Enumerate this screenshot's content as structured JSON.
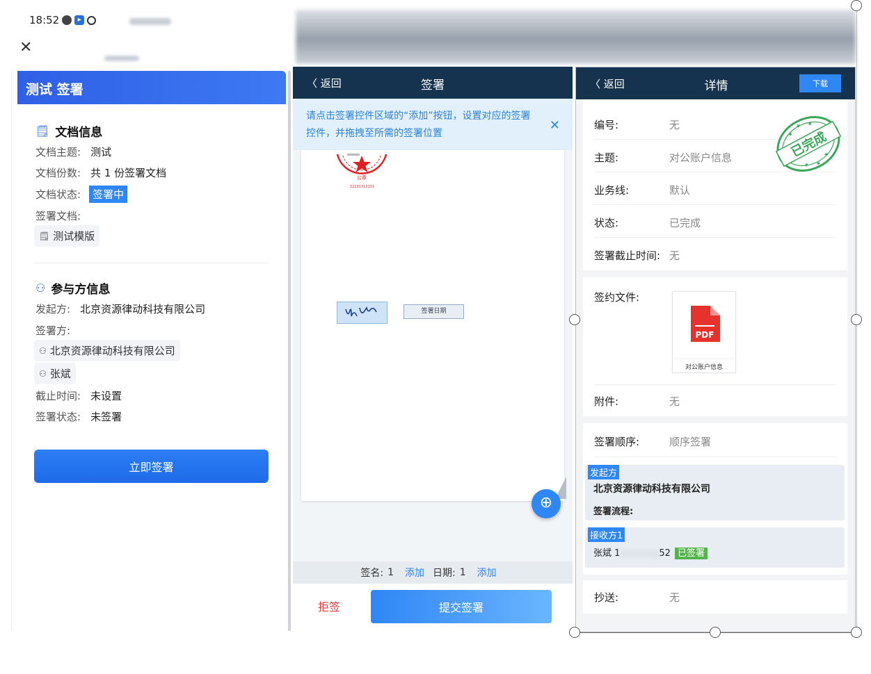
{
  "status_bar": {
    "time": "18:52"
  },
  "panel1": {
    "header_title": "测试 签署",
    "doc_section": {
      "title": "文档信息",
      "subject_label": "文档主题:",
      "subject_value": "测试",
      "copies_label": "文档份数:",
      "copies_value": "共 1 份签署文档",
      "status_label": "文档状态:",
      "status_value": "签署中",
      "files_label": "签署文档:",
      "file_chip": "测试模版"
    },
    "party_section": {
      "title": "参与方信息",
      "initiator_label": "发起方:",
      "initiator_value": "北京资源律动科技有限公司",
      "signers_label": "签署方:",
      "signers": [
        "北京资源律动科技有限公司",
        "张斌"
      ],
      "deadline_label": "截止时间:",
      "deadline_value": "未设置",
      "sign_status_label": "签署状态:",
      "sign_status_value": "未签署"
    },
    "sign_now_button": "立即签署"
  },
  "panel2": {
    "back_label": "返回",
    "title": "签署",
    "tip": "请点击签署控件区域的“添加”按钮，设置对应的签署控件，并拖拽至所需的签署位置",
    "date_field_label": "签署日期",
    "counter": {
      "signature_label": "签名:",
      "signature_count": "1",
      "date_label": "日期:",
      "date_count": "1",
      "add_label": "添加"
    },
    "reject_button": "拒签",
    "submit_button": "提交签署"
  },
  "panel3": {
    "back_label": "返回",
    "title": "详情",
    "download_button": "下载",
    "stamp_text": "已完成",
    "fields": {
      "number_label": "编号:",
      "number_value": "无",
      "subject_label": "主题:",
      "subject_value": "对公账户信息",
      "business_label": "业务线:",
      "business_value": "默认",
      "status_label": "状态:",
      "status_value": "已完成",
      "deadline_label": "签署截止时间:",
      "deadline_value": "无",
      "file_label": "签约文件:",
      "file_name": "对公账户信息",
      "pdf_label": "PDF",
      "attach_label": "附件:",
      "attach_value": "无",
      "order_label": "签署顺序:",
      "order_value": "顺序签署",
      "cc_label": "抄送:",
      "cc_value": "无"
    },
    "initiator": {
      "tag": "发起方",
      "name": "北京资源律动科技有限公司",
      "flow_label": "签署流程:"
    },
    "receiver": {
      "tag": "接收方1",
      "name_prefix": "张斌 1",
      "phone_suffix": "52",
      "signed_tag": "已签署"
    }
  },
  "colors": {
    "nav_bg": "#15324e",
    "accent_blue": "#2f86f5",
    "reject_red": "#e23b3b",
    "seal_red": "#e02020",
    "done_green": "#3aa65a"
  }
}
